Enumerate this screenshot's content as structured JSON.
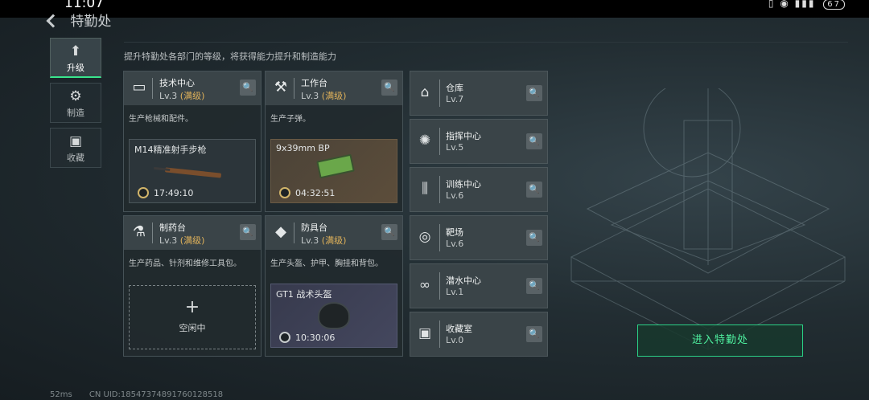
{
  "statusbar": {
    "time": "11:07",
    "battery": "67"
  },
  "header": {
    "title": "特勤处"
  },
  "nav": [
    {
      "label": "升级",
      "icon": "upgrade-icon"
    },
    {
      "label": "制造",
      "icon": "gears-icon"
    },
    {
      "label": "收藏",
      "icon": "collection-icon"
    }
  ],
  "subtitle": "提升特勤处各部门的等级，将获得能力提升和制造能力",
  "cards": [
    {
      "name": "技术中心",
      "level": "Lv.3",
      "max": "(满级)",
      "icon": "monitor-icon",
      "desc": "生产枪械和配件。",
      "product": {
        "name": "M14精准射手步枪",
        "time": "17:49:10"
      }
    },
    {
      "name": "工作台",
      "level": "Lv.3",
      "max": "(满级)",
      "icon": "tools-icon",
      "desc": "生产子弹。",
      "product": {
        "name": "9x39mm BP",
        "time": "04:32:51"
      }
    },
    {
      "name": "制药台",
      "level": "Lv.3",
      "max": "(满级)",
      "icon": "microscope-icon",
      "desc": "生产药品、针剂和维修工具包。",
      "empty": {
        "plus": "+",
        "label": "空闲中"
      }
    },
    {
      "name": "防具台",
      "level": "Lv.3",
      "max": "(满级)",
      "icon": "cubes-icon",
      "desc": "生产头盔、护甲、胸挂和背包。",
      "product": {
        "name": "GT1 战术头盔",
        "time": "10:30:06"
      }
    }
  ],
  "rooms": [
    {
      "name": "仓库",
      "level": "Lv.7",
      "icon": "warehouse-icon"
    },
    {
      "name": "指挥中心",
      "level": "Lv.5",
      "icon": "command-icon"
    },
    {
      "name": "训练中心",
      "level": "Lv.6",
      "icon": "dumbbell-icon"
    },
    {
      "name": "靶场",
      "level": "Lv.6",
      "icon": "target-icon"
    },
    {
      "name": "潜水中心",
      "level": "Lv.1",
      "icon": "diving-icon"
    },
    {
      "name": "收藏室",
      "level": "Lv.0",
      "icon": "collection-room-icon"
    }
  ],
  "enter_button": "进入特勤处",
  "footer": {
    "ping": "52ms",
    "uid": "CN UID:18547374891760128518"
  }
}
